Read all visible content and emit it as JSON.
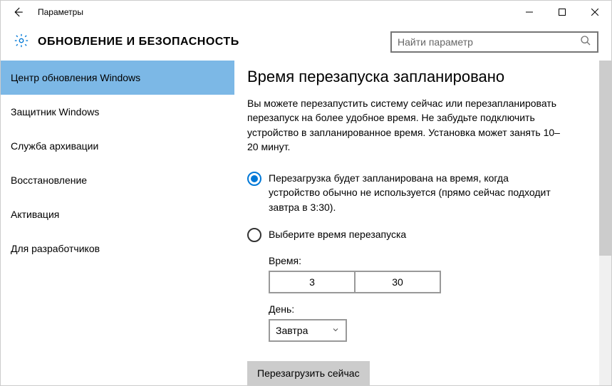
{
  "window": {
    "title": "Параметры"
  },
  "header": {
    "title": "ОБНОВЛЕНИЕ И БЕЗОПАСНОСТЬ",
    "search_placeholder": "Найти параметр"
  },
  "sidebar": {
    "items": [
      {
        "label": "Центр обновления Windows",
        "selected": true
      },
      {
        "label": "Защитник Windows",
        "selected": false
      },
      {
        "label": "Служба архивации",
        "selected": false
      },
      {
        "label": "Восстановление",
        "selected": false
      },
      {
        "label": "Активация",
        "selected": false
      },
      {
        "label": "Для разработчиков",
        "selected": false
      }
    ]
  },
  "content": {
    "title": "Время перезапуска запланировано",
    "description": "Вы можете перезапустить систему сейчас или перезапланировать перезапуск на более удобное время. Не забудьте подключить устройство в запланированное время. Установка может занять 10–20 минут.",
    "radio1": "Перезагрузка будет запланирована на время, когда устройство обычно не используется (прямо сейчас подходит завтра в 3:30).",
    "radio2": "Выберите время перезапуска",
    "time_label": "Время:",
    "time_hour": "3",
    "time_min": "30",
    "day_label": "День:",
    "day_value": "Завтра",
    "restart_btn": "Перезагрузить сейчас"
  }
}
